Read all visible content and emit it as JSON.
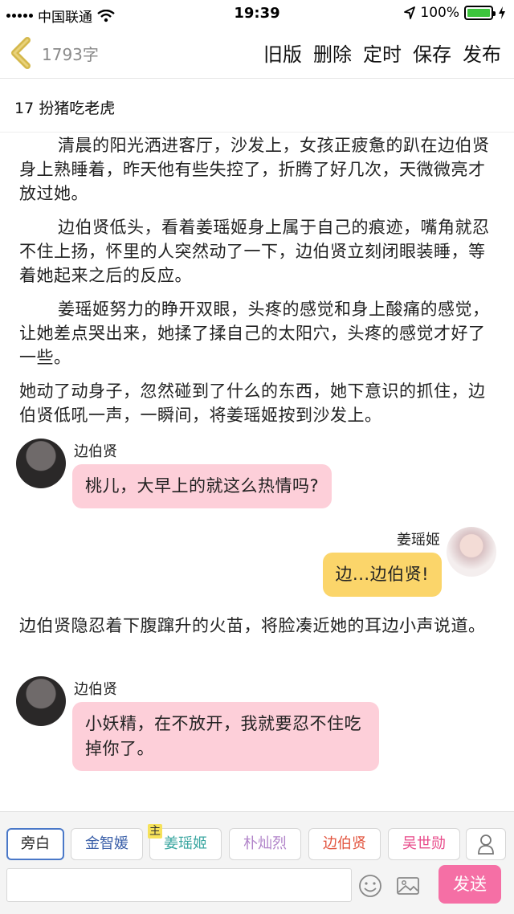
{
  "status_bar": {
    "carrier": "中国联通",
    "time": "19:39",
    "battery": "100%",
    "battery_level": 1.0
  },
  "header": {
    "word_count": "1793字",
    "actions": [
      "旧版",
      "删除",
      "定时",
      "保存",
      "发布"
    ]
  },
  "chapter": {
    "title": "17 扮猪吃老虎"
  },
  "content": {
    "paragraphs": [
      "清晨的阳光洒进客厅，沙发上，女孩正疲惫的趴在边伯贤身上熟睡着，昨天他有些失控了，折腾了好几次，天微微亮才放过她。",
      "边伯贤低头，看着姜瑶姬身上属于自己的痕迹，嘴角就忍不住上扬，怀里的人突然动了一下，边伯贤立刻闭眼装睡，等着她起来之后的反应。",
      "姜瑶姬努力的睁开双眼，头疼的感觉和身上酸痛的感觉，让她差点哭出来，她揉了揉自己的太阳穴，头疼的感觉才好了一些。",
      "她动了动身子，忽然碰到了什么的东西，她下意识的抓住，边伯贤低吼一声，一瞬间，将姜瑶姬按到沙发上。"
    ],
    "messages": [
      {
        "speaker": "边伯贤",
        "text": "桃儿，大早上的就这么热情吗?"
      },
      {
        "speaker": "姜瑶姬",
        "text": "边...边伯贤!"
      },
      {
        "speaker": "边伯贤",
        "text": "小妖精，在不放开，我就要忍不住吃掉你了。"
      }
    ],
    "narration_after": "边伯贤隐忍着下腹蹿升的火苗，将脸凑近她的耳边小声说道。"
  },
  "toolbar": {
    "roles": [
      {
        "label": "旁白",
        "color": "#222222"
      },
      {
        "label": "金智媛",
        "color": "#3a5fa8"
      },
      {
        "label": "姜瑶姬",
        "color": "#3aa6a0",
        "badge": "主"
      },
      {
        "label": "朴灿烈",
        "color": "#b184c9"
      },
      {
        "label": "边伯贤",
        "color": "#e2543e"
      },
      {
        "label": "吴世勋",
        "color": "#e84c8b"
      }
    ],
    "send_label": "发送"
  }
}
